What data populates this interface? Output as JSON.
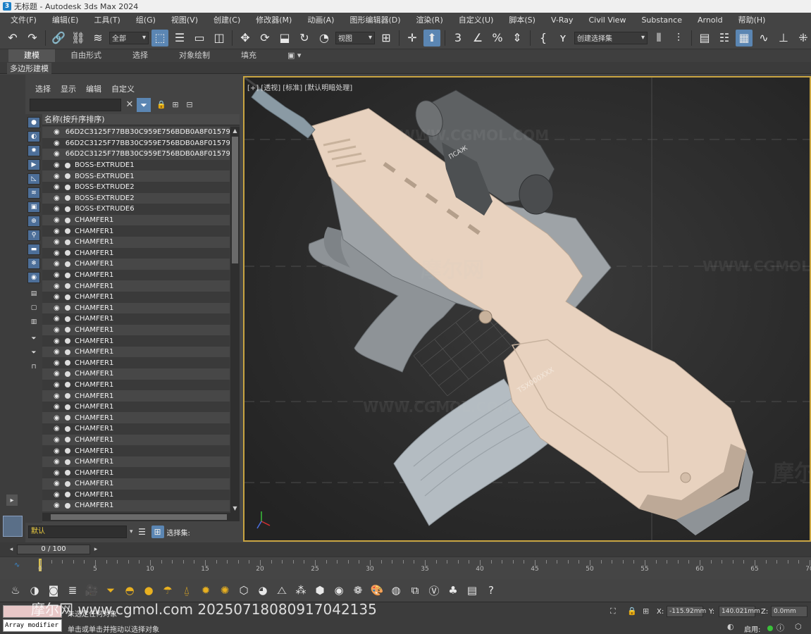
{
  "window": {
    "title": "无标题 - Autodesk 3ds Max 2024",
    "app_icon": "3"
  },
  "menu": {
    "items": [
      "文件(F)",
      "编辑(E)",
      "工具(T)",
      "组(G)",
      "视图(V)",
      "创建(C)",
      "修改器(M)",
      "动画(A)",
      "图形编辑器(D)",
      "渲染(R)",
      "自定义(U)",
      "脚本(S)",
      "V-Ray",
      "Civil View",
      "Substance",
      "Arnold",
      "帮助(H)"
    ]
  },
  "toolbar": {
    "selection_filter": "全部",
    "reference_coord": "视图",
    "named_selection_set": "创建选择集"
  },
  "ribbon": {
    "tabs": [
      "建模",
      "自由形式",
      "选择",
      "对象绘制",
      "填充"
    ],
    "active_tab": "建模",
    "sub_label": "多边形建模"
  },
  "explorer": {
    "menu": [
      "选择",
      "显示",
      "编辑",
      "自定义"
    ],
    "search_placeholder": "",
    "column_header": "名称(按升序排序)",
    "rows": [
      "66D2C3125F77BB30C959E756BDB0A8F01579",
      "66D2C3125F77BB30C959E756BDB0A8F01579",
      "66D2C3125F77BB30C959E756BDB0A8F01579",
      "BOSS-EXTRUDE1",
      "BOSS-EXTRUDE1",
      "BOSS-EXTRUDE2",
      "BOSS-EXTRUDE2",
      "BOSS-EXTRUDE6",
      "CHAMFER1",
      "CHAMFER1",
      "CHAMFER1",
      "CHAMFER1",
      "CHAMFER1",
      "CHAMFER1",
      "CHAMFER1",
      "CHAMFER1",
      "CHAMFER1",
      "CHAMFER1",
      "CHAMFER1",
      "CHAMFER1",
      "CHAMFER1",
      "CHAMFER1",
      "CHAMFER1",
      "CHAMFER1",
      "CHAMFER1",
      "CHAMFER1",
      "CHAMFER1",
      "CHAMFER1",
      "CHAMFER1",
      "CHAMFER1",
      "CHAMFER1",
      "CHAMFER1",
      "CHAMFER1",
      "CHAMFER1",
      "CHAMFER1",
      "CHAMFER1",
      "CHAMFER1",
      "CHAMFER1"
    ],
    "layer": "默认",
    "selection_set_label": "选择集:"
  },
  "viewport": {
    "label": "[+] [透视] [标准] [默认明暗处理]",
    "watermarks": [
      "WWW.CGMOL.COM",
      "摩尔网"
    ],
    "gun_markings": [
      "ПСАЖ",
      "TSX000XXX"
    ],
    "colors": {
      "receiver": "#e8d2bf",
      "polymer": "#8e9397",
      "magazine": "#b4bcc2",
      "optic": "#5e6163",
      "border": "#c8a441"
    }
  },
  "timeline": {
    "frame_display": "0 / 100",
    "ticks": [
      0,
      5,
      10,
      15,
      20,
      25,
      30,
      35,
      40,
      45,
      50,
      55,
      60,
      65,
      70
    ]
  },
  "status": {
    "watermark": "摩尔网 www.cgmol.com 20250718080917042135",
    "maxscript": "Array modifier",
    "message1": "未选定任何对象",
    "message2": "单击或单击并拖动以选择对象",
    "x_label": "X:",
    "x_value": "-115.92mm",
    "y_label": "Y:",
    "y_value": "140.021mm",
    "z_label": "Z:",
    "z_value": "0.0mm",
    "enable_label": "启用:",
    "enable_color": "#3ac03a"
  }
}
